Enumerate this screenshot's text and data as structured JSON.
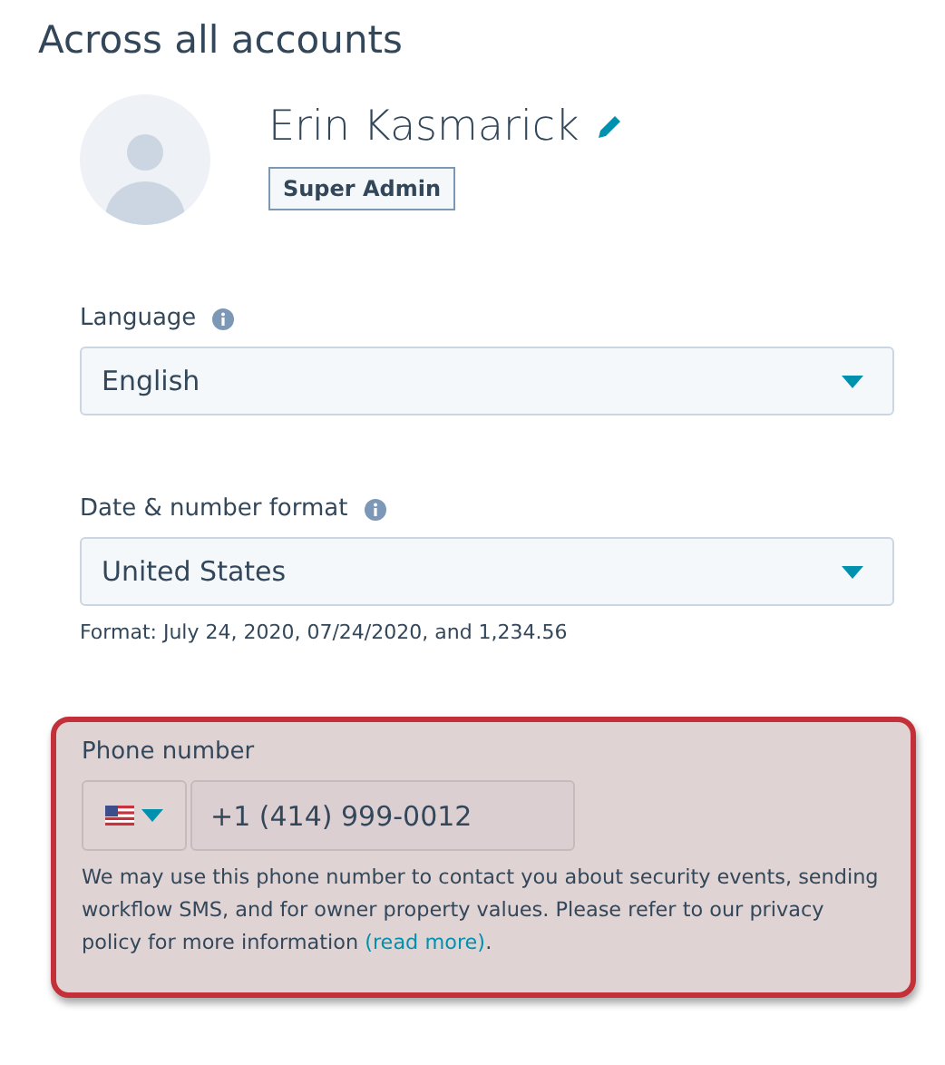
{
  "heading": "Across all accounts",
  "profile": {
    "name": "Erin Kasmarick",
    "role": "Super Admin"
  },
  "fields": [
    {
      "label": "Language",
      "value": "English"
    },
    {
      "label": "Date & number format",
      "value": "United States",
      "hint": "Format: July 24, 2020, 07/24/2020, and 1,234.56"
    }
  ],
  "phone": {
    "label": "Phone number",
    "value": "+1 (414) 999-0012",
    "help": "We may use this phone number to contact you about security events, sending workflow SMS, and for owner property values. Please refer to our privacy policy for more information ",
    "link": "(read more)",
    "suffix": "."
  }
}
